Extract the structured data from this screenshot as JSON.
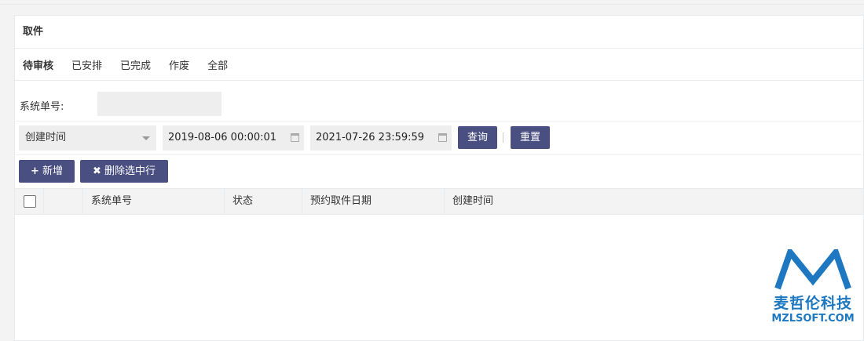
{
  "panel": {
    "title": "取件"
  },
  "tabs": [
    {
      "label": "待审核"
    },
    {
      "label": "已安排"
    },
    {
      "label": "已完成"
    },
    {
      "label": "作废"
    },
    {
      "label": "全部"
    }
  ],
  "search": {
    "sysno_label": "系统单号:",
    "sysno_value": ""
  },
  "filter": {
    "date_field": "创建时间",
    "start_date": "2019-08-06 00:00:01",
    "end_date": "2021-07-26 23:59:59",
    "query_label": "查询",
    "reset_label": "重置"
  },
  "actions": {
    "add_icon": "+",
    "add_label": "新增",
    "delete_icon": "✖",
    "delete_label": "删除选中行"
  },
  "table": {
    "columns": [
      "",
      "",
      "系统单号",
      "状态",
      "预约取件日期",
      "创建时间"
    ]
  },
  "watermark": {
    "cn": "麦哲伦科技",
    "en": "MZLSOFT.COM"
  },
  "colors": {
    "primary_button": "#4a4f82",
    "brand": "#1d78c1"
  }
}
